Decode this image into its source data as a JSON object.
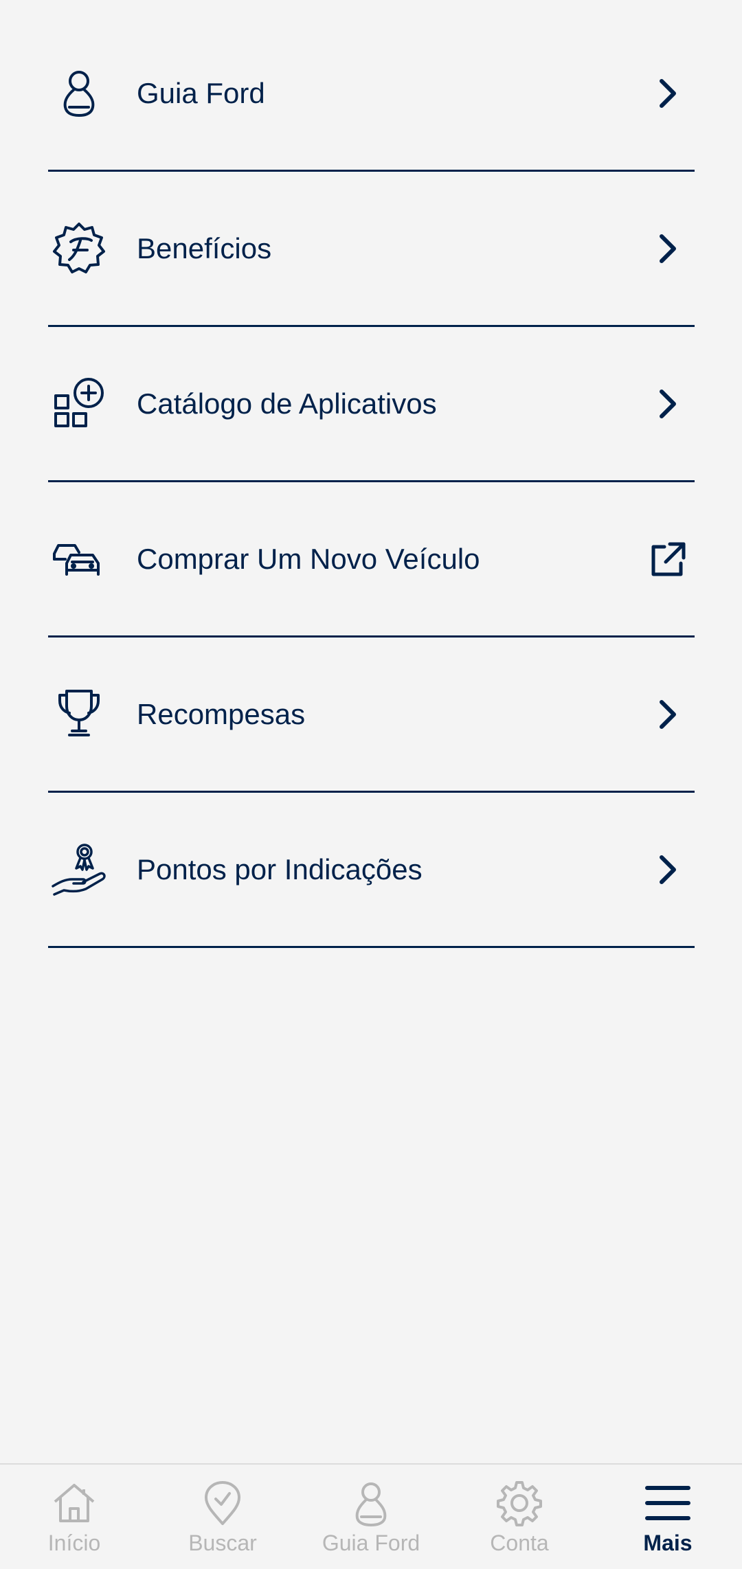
{
  "menu": {
    "items": [
      {
        "label": "Guia Ford",
        "icon": "person-icon",
        "trailing": "chevron-right-icon"
      },
      {
        "label": "Benefícios",
        "icon": "ford-badge-icon",
        "trailing": "chevron-right-icon"
      },
      {
        "label": "Catálogo de Aplicativos",
        "icon": "app-catalog-icon",
        "trailing": "chevron-right-icon"
      },
      {
        "label": "Comprar Um Novo Veículo",
        "icon": "cars-icon",
        "trailing": "external-link-icon"
      },
      {
        "label": "Recompesas",
        "icon": "trophy-icon",
        "trailing": "chevron-right-icon"
      },
      {
        "label": "Pontos por Indicações",
        "icon": "award-hand-icon",
        "trailing": "chevron-right-icon"
      }
    ]
  },
  "bottom_nav": {
    "tabs": [
      {
        "label": "Início",
        "icon": "home-icon",
        "active": false
      },
      {
        "label": "Buscar",
        "icon": "map-pin-icon",
        "active": false
      },
      {
        "label": "Guia Ford",
        "icon": "person-icon",
        "active": false
      },
      {
        "label": "Conta",
        "icon": "gear-icon",
        "active": false
      },
      {
        "label": "Mais",
        "icon": "menu-icon",
        "active": true
      }
    ]
  },
  "colors": {
    "primary": "#00214a",
    "inactive": "#b6b6b6",
    "background": "#f4f4f4"
  }
}
